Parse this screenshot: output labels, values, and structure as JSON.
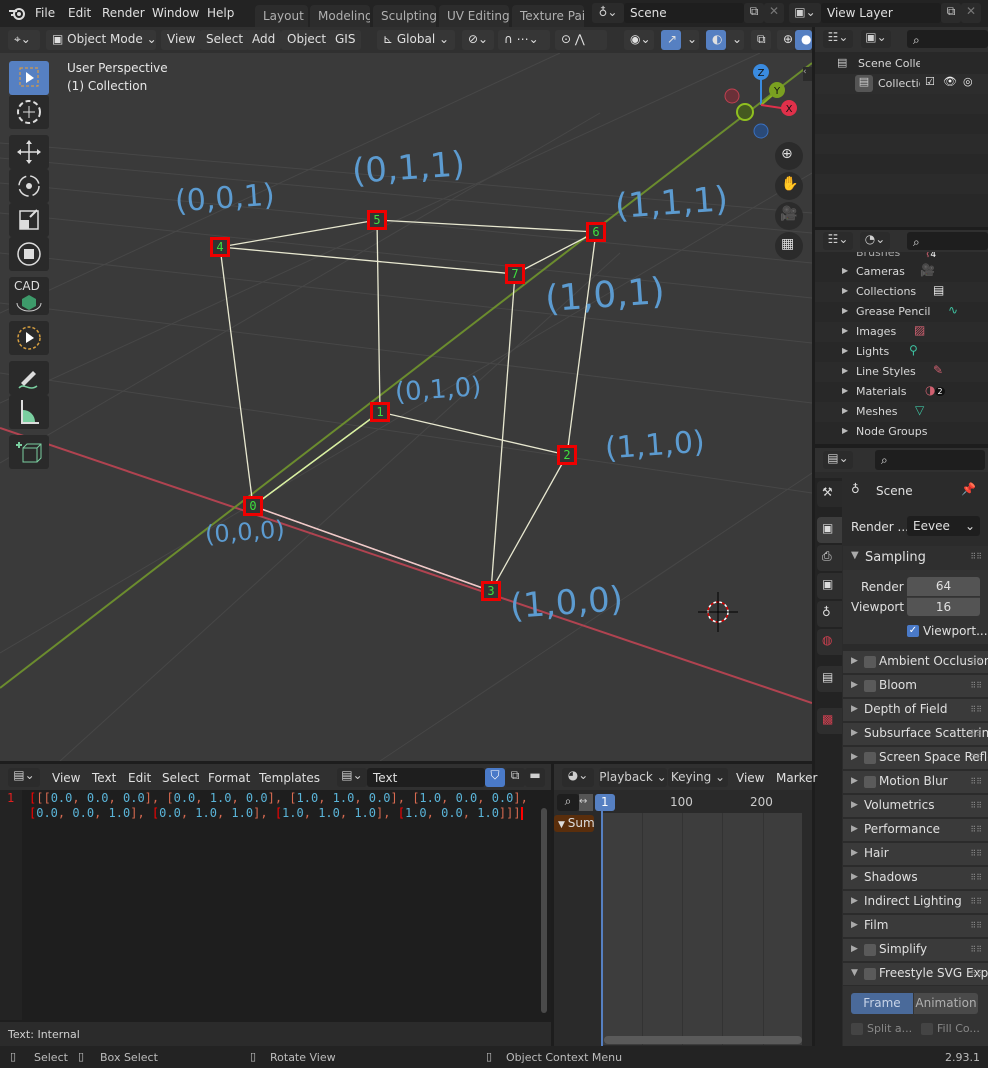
{
  "topbar": {
    "menus": [
      "File",
      "Edit",
      "Render",
      "Window",
      "Help"
    ],
    "workspaces": [
      "Layout",
      "Modeling",
      "Sculpting",
      "UV Editing",
      "Texture Paint"
    ],
    "scene_label": "Scene",
    "view_layer_label": "View Layer"
  },
  "viewport_header": {
    "mode": "Object Mode",
    "menus": [
      "View",
      "Select",
      "Add",
      "Object",
      "GIS"
    ],
    "transform_orientation": "Global"
  },
  "viewport": {
    "title": "User Perspective",
    "subtitle": "(1) Collection",
    "gizmo_axes": {
      "x": "X",
      "y": "Y",
      "z": "Z"
    },
    "tools": [
      "select-box",
      "cursor",
      "move",
      "rotate",
      "scale",
      "transform",
      "cad-transform",
      "select-circle",
      "annotate",
      "measure",
      "add-cube"
    ],
    "cad_label": "CAD",
    "vertices": [
      {
        "index": "0",
        "coord": [
          0.0,
          0.0,
          0.0
        ],
        "annotation": "(0,0,0)"
      },
      {
        "index": "1",
        "coord": [
          0.0,
          1.0,
          0.0
        ],
        "annotation": "(0,1,0)"
      },
      {
        "index": "2",
        "coord": [
          1.0,
          1.0,
          0.0
        ],
        "annotation": "(1,1,0)"
      },
      {
        "index": "3",
        "coord": [
          1.0,
          0.0,
          0.0
        ],
        "annotation": "(1,0,0)"
      },
      {
        "index": "4",
        "coord": [
          0.0,
          0.0,
          1.0
        ],
        "annotation": "(0,0,1)"
      },
      {
        "index": "5",
        "coord": [
          0.0,
          1.0,
          1.0
        ],
        "annotation": "(0,1,1)"
      },
      {
        "index": "6",
        "coord": [
          1.0,
          1.0,
          1.0
        ],
        "annotation": "(1,1,1)"
      },
      {
        "index": "7",
        "coord": [
          1.0,
          0.0,
          1.0
        ],
        "annotation": "(1,0,1)"
      }
    ]
  },
  "outliner": {
    "scene_collection": "Scene Collection",
    "collection": "Collection"
  },
  "datablocks": {
    "partial_top": "Brushes",
    "brushes_count": "4",
    "items": [
      "Cameras",
      "Collections",
      "Grease Pencil",
      "Images",
      "Lights",
      "Line Styles",
      "Materials",
      "Meshes",
      "Node Groups"
    ],
    "materials_count": "2"
  },
  "properties": {
    "context": "Scene",
    "render_engine_label": "Render ...",
    "render_engine": "Eevee",
    "sampling": {
      "title": "Sampling",
      "render_label": "Render",
      "render_value": "64",
      "viewport_label": "Viewport",
      "viewport_value": "16",
      "viewport_denoise_label": "Viewport...",
      "viewport_denoise_checked": true
    },
    "panels": [
      {
        "label": "Ambient Occlusion",
        "checkbox": true
      },
      {
        "label": "Bloom",
        "checkbox": true
      },
      {
        "label": "Depth of Field",
        "checkbox": false
      },
      {
        "label": "Subsurface Scattering",
        "checkbox": false
      },
      {
        "label": "Screen Space Reflections",
        "checkbox": true
      },
      {
        "label": "Motion Blur",
        "checkbox": true
      },
      {
        "label": "Volumetrics",
        "checkbox": false
      },
      {
        "label": "Performance",
        "checkbox": false
      },
      {
        "label": "Hair",
        "checkbox": false
      },
      {
        "label": "Shadows",
        "checkbox": false
      },
      {
        "label": "Indirect Lighting",
        "checkbox": false
      },
      {
        "label": "Film",
        "checkbox": false
      },
      {
        "label": "Simplify",
        "checkbox": true
      },
      {
        "label": "Freestyle SVG Export",
        "checkbox": true
      }
    ],
    "freestyle": {
      "frame_label": "Frame",
      "animation_label": "Animation",
      "split_label": "Split a...",
      "fill_label": "Fill Co..."
    }
  },
  "text_editor": {
    "menus": [
      "View",
      "Text",
      "Edit",
      "Select",
      "Format",
      "Templates"
    ],
    "datablock_name": "Text",
    "line_number": "1",
    "line1": "[[[0.0, 0.0, 0.0], [0.0, 1.0, 0.0], [1.0, 1.0, 0.0], [1.0, 0.0, 0.0],",
    "line2": "[0.0, 0.0, 1.0], [0.0, 1.0, 1.0], [1.0, 1.0, 1.0], [1.0, 0.0, 1.0]]]",
    "footer": "Text: Internal"
  },
  "timeline": {
    "menus": [
      "Playback",
      "Keying",
      "View",
      "Marker"
    ],
    "current_frame": "1",
    "ticks": [
      "100",
      "200"
    ],
    "summary_label": "Summary"
  },
  "statusbar": {
    "select": "Select",
    "box_select": "Box Select",
    "rotate_view": "Rotate View",
    "context_menu": "Object Context Menu",
    "version": "2.93.1"
  },
  "colors": {
    "accent": "#5680c2",
    "vertex_marker": "#ee0000",
    "vertex_label": "#3ee03e",
    "x_axis": "#c0404c",
    "y_axis": "#7a9a2e",
    "handwriting": "#5c9bd0"
  }
}
